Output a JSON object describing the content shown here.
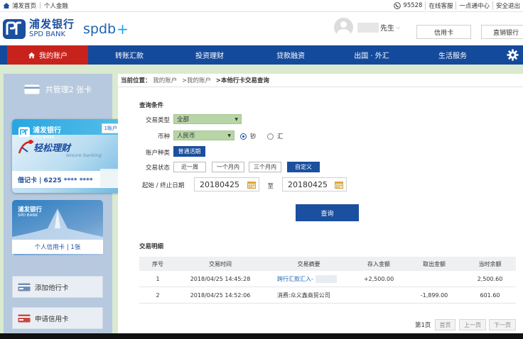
{
  "topbar": {
    "home": "浦发首页",
    "personal": "个人金融",
    "phone": "95528",
    "links": [
      "在线客服",
      "一点通中心",
      "安全退出"
    ]
  },
  "header": {
    "logo_cn": "浦发银行",
    "logo_en": "SPD BANK",
    "logo_spdb": "spdb",
    "user_suffix": "先生",
    "credit_btn": "信用卡",
    "direct_btn": "直销银行"
  },
  "nav": {
    "items": [
      "我的账户",
      "转账汇款",
      "投资理财",
      "贷款融资",
      "出国 · 外汇",
      "生活服务"
    ]
  },
  "sidebar": {
    "title": "共管理2 张卡",
    "card1": {
      "brand_cn": "浦发银行",
      "brand_en": "SPD BANK",
      "badge": "1账户",
      "product": "轻松理财",
      "product_en": "leisure banking",
      "number": "借记卡 | 6225 **** ****"
    },
    "card2": {
      "brand_cn": "浦发银行",
      "brand_en": "SPD BANK",
      "label": "个人信用卡 | 1张"
    },
    "add_other": "添加他行卡",
    "apply_credit": "申请信用卡"
  },
  "main": {
    "breadcrumb_prefix": "当前位置：",
    "breadcrumb_1": "我的账户",
    "breadcrumb_2": ">我的账户",
    "breadcrumb_3": ">本他行卡交易查询",
    "query_title": "查询条件",
    "labels": {
      "type": "交易类型",
      "currency": "币种",
      "account_kind": "账户种类",
      "status": "交易状态",
      "date_range": "起始 / 终止日期",
      "to": "至"
    },
    "type_value": "全部",
    "currency_value": "人民币",
    "radio_cash": "钞",
    "radio_remit": "汇",
    "account_kind_value": "普通活期",
    "status_tags": [
      "近一周",
      "一个月内",
      "三个月内",
      "自定义"
    ],
    "start_date": "20180425",
    "end_date": "20180425",
    "query_btn": "查询",
    "detail_title": "交易明细",
    "columns": [
      "序号",
      "交易时间",
      "交易摘要",
      "存入金额",
      "取出金额",
      "当时余额"
    ],
    "rows": [
      [
        "1",
        "2018/04/25 14:45:28",
        "跨行汇款汇入-",
        "+2,500.00",
        "",
        "2,500.60"
      ],
      [
        "2",
        "2018/04/25 14:52:06",
        "消费:众义鑫商贸公司",
        "",
        "-1,899.00",
        "601.60"
      ]
    ],
    "pager": {
      "page": "第1页",
      "first": "首页",
      "prev": "上一页",
      "next": "下一页"
    }
  }
}
